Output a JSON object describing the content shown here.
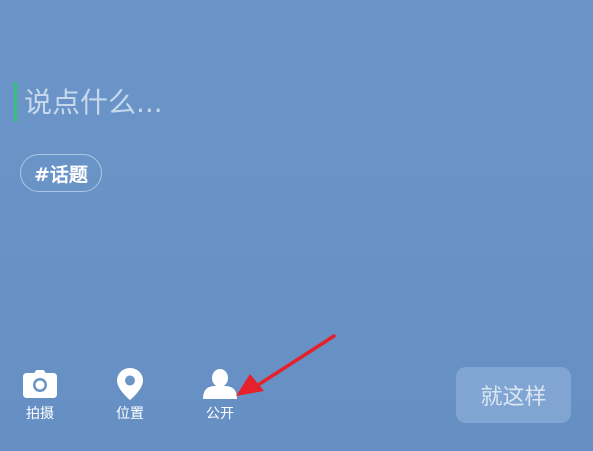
{
  "composer": {
    "placeholder": "说点什么...",
    "value": ""
  },
  "topic": {
    "label": "#话题"
  },
  "toolbar": {
    "items": [
      {
        "label": "拍摄",
        "icon": "camera-icon"
      },
      {
        "label": "位置",
        "icon": "location-pin-icon"
      },
      {
        "label": "公开",
        "icon": "person-icon"
      }
    ],
    "submit_label": "就这样"
  },
  "colors": {
    "background": "#6b94c7",
    "caret": "#33c27a",
    "annotation_arrow": "#e5212b",
    "text": "#ffffff"
  }
}
